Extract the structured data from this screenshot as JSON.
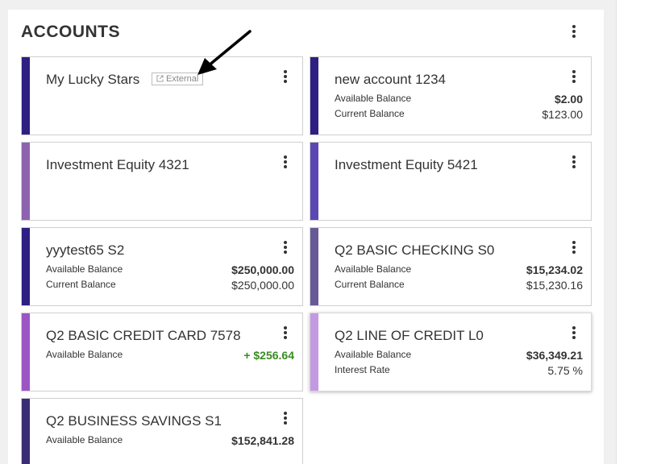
{
  "panel": {
    "title": "ACCOUNTS",
    "menu_icon": "kebab-menu-icon"
  },
  "cards": [
    {
      "name": "My Lucky Stars",
      "badge": "External",
      "bar_color": "#2e1f82"
    },
    {
      "name": "new account 1234",
      "bar_color": "#2e1f82",
      "rows": [
        {
          "label": "Available Balance",
          "value": "$2.00"
        },
        {
          "label": "Current Balance",
          "value": "$123.00"
        }
      ]
    },
    {
      "name": "Investment Equity 4321",
      "bar_color": "#8d63b0"
    },
    {
      "name": "Investment Equity 5421",
      "bar_color": "#5b47b2"
    },
    {
      "name": "yyytest65 S2",
      "bar_color": "#2e1f82",
      "rows": [
        {
          "label": "Available Balance",
          "value": "$250,000.00"
        },
        {
          "label": "Current Balance",
          "value": "$250,000.00"
        }
      ]
    },
    {
      "name": "Q2 BASIC CHECKING S0",
      "bar_color": "#675a96",
      "rows": [
        {
          "label": "Available Balance",
          "value": "$15,234.02"
        },
        {
          "label": "Current Balance",
          "value": "$15,230.16"
        }
      ]
    },
    {
      "name": "Q2 BASIC CREDIT CARD 7578",
      "bar_color": "#9b56c4",
      "rows": [
        {
          "label": "Available Balance",
          "value": "+ $256.64"
        }
      ]
    },
    {
      "name": "Q2 LINE OF CREDIT L0",
      "bar_color": "#c39ae2",
      "rows": [
        {
          "label": "Available Balance",
          "value": "$36,349.21"
        },
        {
          "label": "Interest Rate",
          "value": "5.75 %"
        }
      ]
    },
    {
      "name": "Q2 BUSINESS SAVINGS S1",
      "bar_color": "#3b2d73",
      "rows": [
        {
          "label": "Available Balance",
          "value": "$152,841.28"
        }
      ]
    }
  ]
}
